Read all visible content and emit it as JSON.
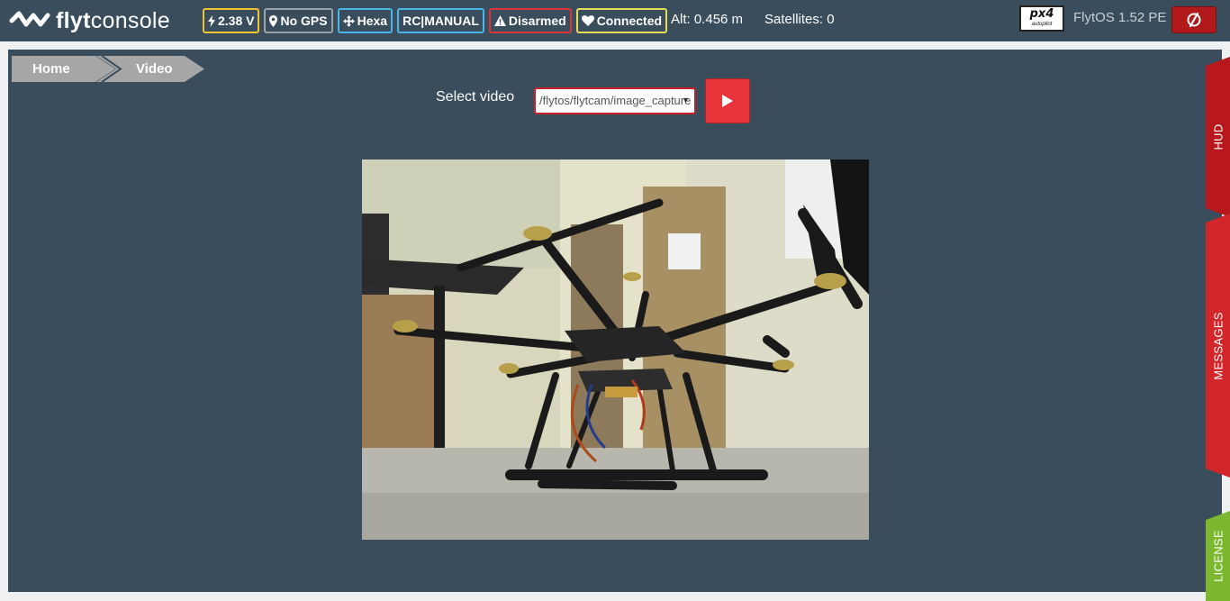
{
  "header": {
    "logo_bold": "flyt",
    "logo_rest": "console",
    "badges": [
      {
        "icon": "bolt-icon",
        "label": "2.38 V",
        "color": "#f0c330"
      },
      {
        "icon": "map-pin-icon",
        "label": "No GPS",
        "color": "#9aa3aa"
      },
      {
        "icon": "move-arrows-icon",
        "label": "Hexa",
        "color": "#49b6e8"
      },
      {
        "icon": "",
        "label": "RC|MANUAL",
        "color": "#49b6e8"
      },
      {
        "icon": "warning-icon",
        "label": "Disarmed",
        "color": "#d9363a"
      },
      {
        "icon": "heart-icon",
        "label": "Connected",
        "color": "#e6dc5a"
      }
    ],
    "altitude": "Alt: 0.456 m",
    "satellites": "Satellites: 0",
    "autopilot_logo": "px4",
    "autopilot_sub": "autopilot",
    "version": "FlytOS 1.52 PE",
    "power_icon": "power-icon"
  },
  "breadcrumb": {
    "home": "Home",
    "current": "Video"
  },
  "video_controls": {
    "label": "Select video",
    "selected": "/flytos/flytcam/image_capture",
    "play_icon": "play-icon"
  },
  "side_tabs": {
    "hud": "HUD",
    "messages": "MESSAGES",
    "license": "LICENSE"
  },
  "colors": {
    "topbar": "#3a4d5c",
    "accent_red": "#e8353a",
    "license_green": "#7cb82f"
  }
}
